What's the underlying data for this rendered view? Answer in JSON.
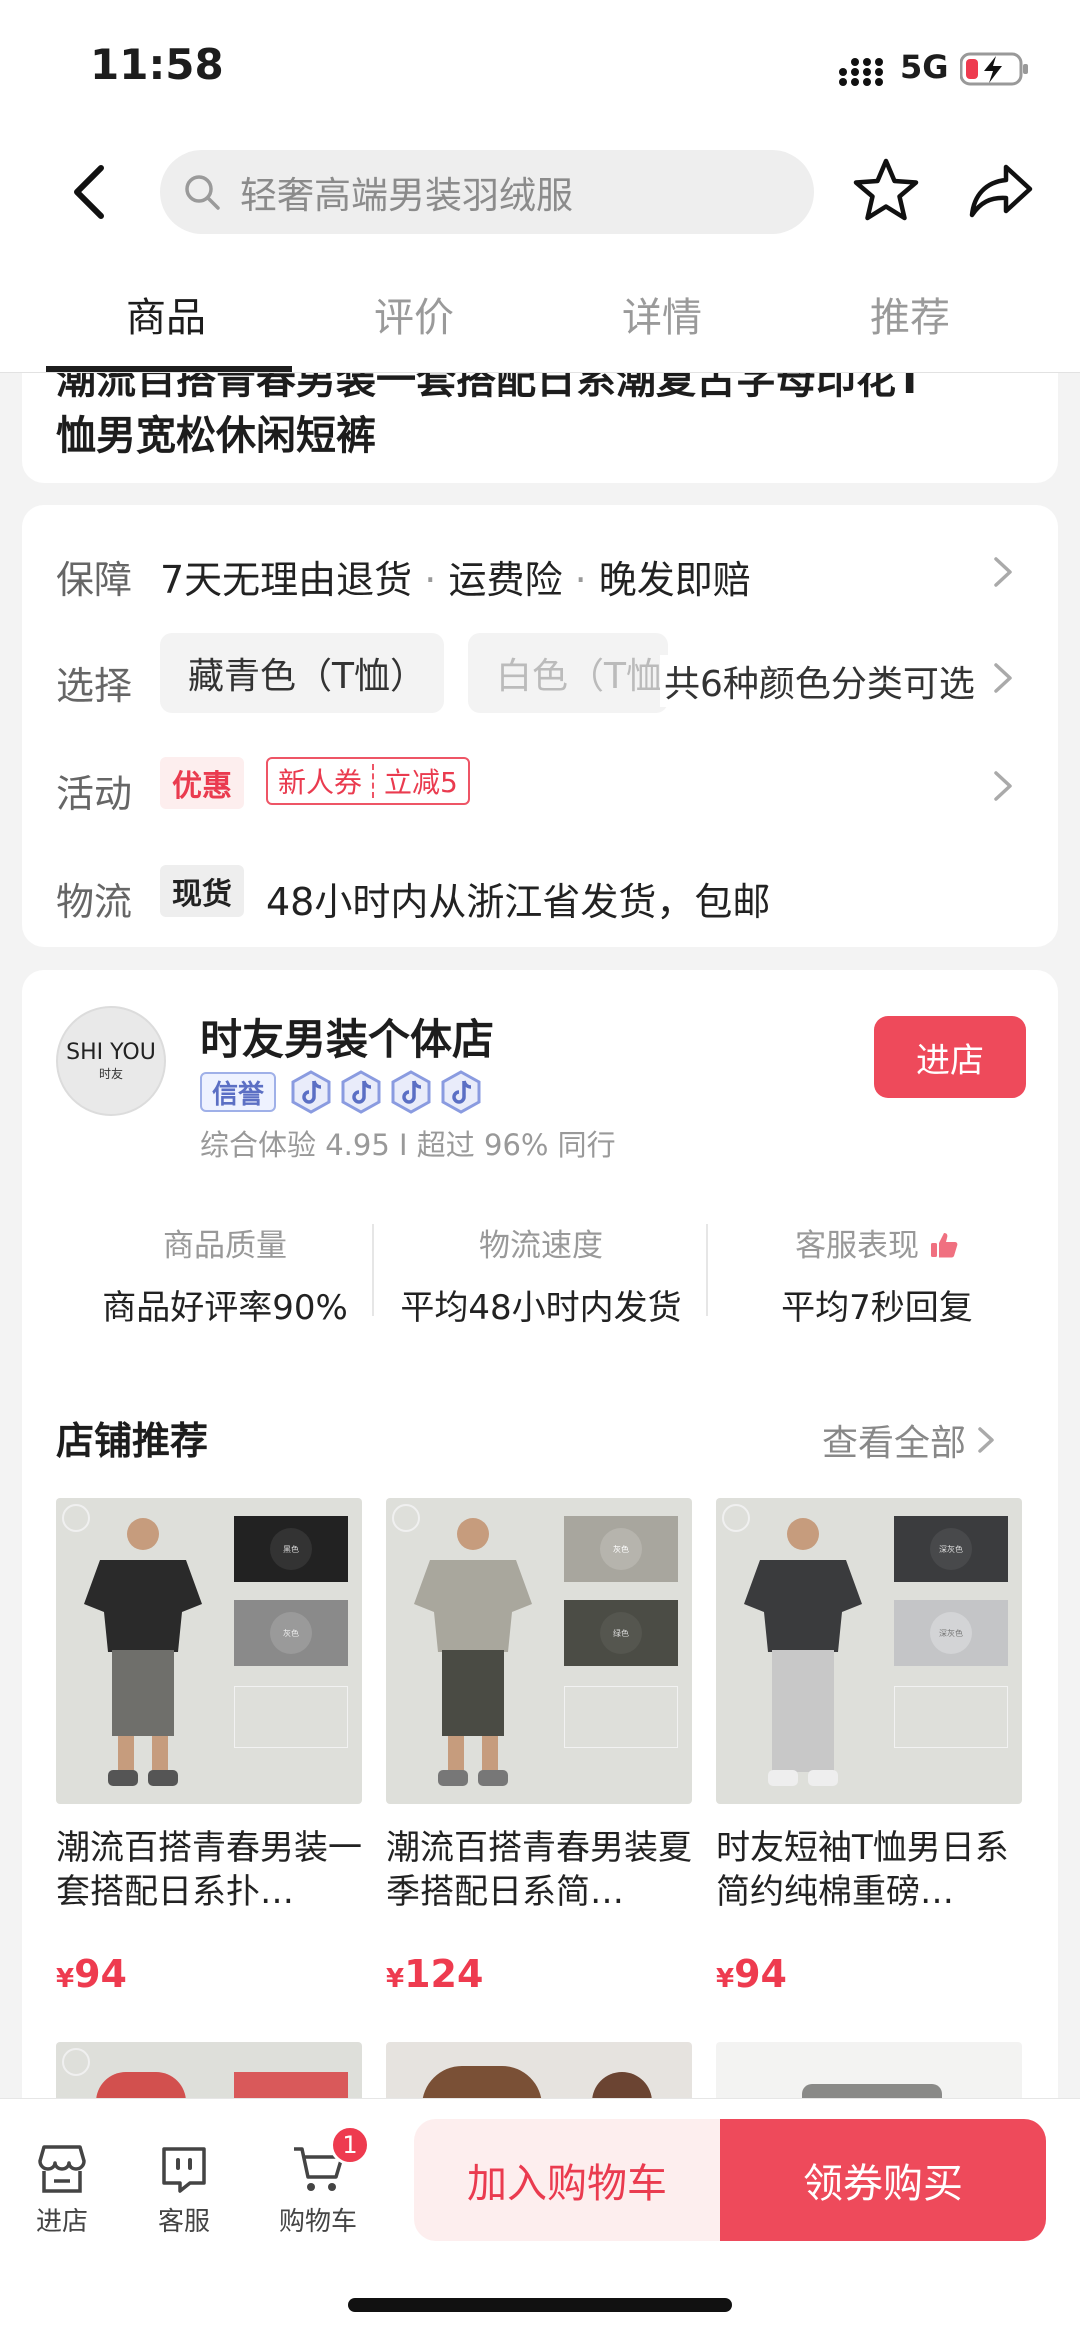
{
  "status": {
    "time": "11:58",
    "network": "5G"
  },
  "header": {
    "search_placeholder": "轻奢高端男装羽绒服"
  },
  "tabs": [
    {
      "label": "商品",
      "active": true
    },
    {
      "label": "评价",
      "active": false
    },
    {
      "label": "详情",
      "active": false
    },
    {
      "label": "推荐",
      "active": false
    }
  ],
  "title": {
    "line1_partial": "潮流百搭青春男装一套搭配日系潮复古字母印花T",
    "line2": "恤男宽松休闲短裤"
  },
  "service": {
    "guarantee_label": "保障",
    "guarantee_items": [
      "7天无理由退货",
      "运费险",
      "晚发即赔"
    ],
    "guarantee_sep": "·",
    "select_label": "选择",
    "select_options": [
      "藏青色（T恤）",
      "白色（T恤"
    ],
    "select_more": "共6种颜色分类可选",
    "activity_label": "活动",
    "activity_tag": "优惠",
    "coupon_left": "新人券",
    "coupon_right": "立减5",
    "logistics_label": "物流",
    "logistics_tag": "现货",
    "logistics_text": "48小时内从浙江省发货，包邮"
  },
  "shop": {
    "logo_main": "SHI YOU",
    "logo_sub": "时友",
    "name": "时友男装个体店",
    "credit_label": "信誉",
    "badge_count": 4,
    "score_text": "综合体验 4.95 I 超过 96% 同行",
    "enter_label": "进店",
    "metrics": [
      {
        "label": "商品质量",
        "value": "商品好评率90%"
      },
      {
        "label": "物流速度",
        "value": "平均48小时内发货"
      },
      {
        "label": "客服表现",
        "value": "平均7秒回复"
      }
    ],
    "recommend_title": "店铺推荐",
    "view_all": "查看全部"
  },
  "products": [
    {
      "name": "潮流百搭青春男装一套搭配日系扑…",
      "currency": "¥",
      "price": "94",
      "swatch1": "黑色",
      "swatch2": "灰色",
      "shirt_color": "#2a2a2a",
      "pants_color": "#6f6f6b"
    },
    {
      "name": "潮流百搭青春男装夏季搭配日系简…",
      "currency": "¥",
      "price": "124",
      "swatch1": "灰色",
      "swatch2": "绿色",
      "shirt_color": "#a9a79d",
      "pants_color": "#4a4b44"
    },
    {
      "name": "时友短袖T恤男日系简约纯棉重磅…",
      "currency": "¥",
      "price": "94",
      "swatch1": "深灰色",
      "swatch2": "深灰色",
      "shirt_color": "#3a3b3d",
      "pants_color": "#c8c8c8"
    }
  ],
  "bottom": {
    "shop_label": "进店",
    "service_label": "客服",
    "cart_label": "购物车",
    "cart_count": "1",
    "add_cart": "加入购物车",
    "buy": "领券购买"
  },
  "colors": {
    "accent": "#ee4a5b",
    "price": "#ee3b4f"
  }
}
